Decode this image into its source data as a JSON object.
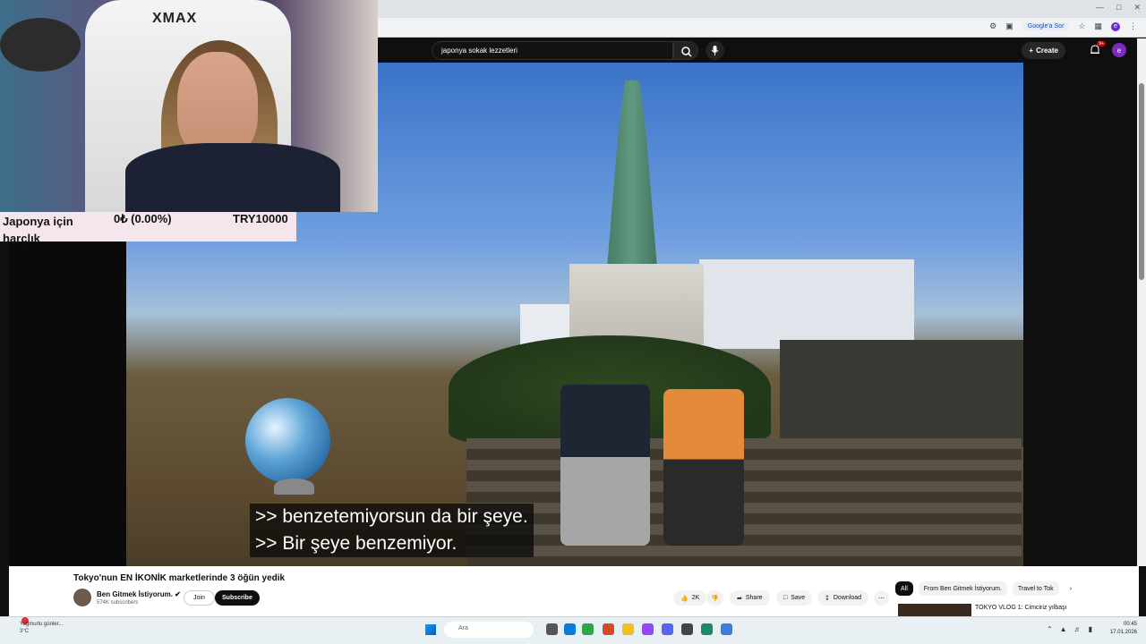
{
  "browser": {
    "google_sor": "Google'a Sor",
    "profile_initial": "e"
  },
  "youtube": {
    "search_value": "japonya sokak lezzetleri",
    "create_label": "Create",
    "notif_badge": "9+",
    "avatar_initial": "e"
  },
  "subtitles": {
    "line1": ">> benzetemiyorsun da bir şeye.",
    "line2": ">> Bir şeye benzemiyor."
  },
  "webcam": {
    "chair_brand": "XMAX"
  },
  "tracker": {
    "label": "Japonya için harçlık",
    "amount": "0₺ (0.00%)",
    "goal": "TRY10000"
  },
  "video": {
    "title": "Tokyo'nun EN İKONİK marketlerinde 3 öğün yedik",
    "channel": "Ben Gitmek İstiyorum.",
    "subscribers": "574K subscribers",
    "join_label": "Join",
    "subscribe_label": "Subscribe",
    "like_count": "2K",
    "share_label": "Share",
    "save_label": "Save",
    "download_label": "Download"
  },
  "recommendations": {
    "chips": [
      "All",
      "From Ben Gitmek İstiyorum.",
      "Travel to Tok"
    ],
    "first_title": "TOKYO VLOG 1: Cimciriz yılbaşı"
  },
  "taskbar": {
    "weather_text": "Yağmurlu günler...",
    "weather_temp": "3°C",
    "search_placeholder": "Ara",
    "time": "00:45",
    "date": "17.01.2026"
  },
  "colors": {
    "accent_red": "#cc0000",
    "yt_dark": "#0f0f0f",
    "tracker_bg": "#f5e6ee"
  }
}
